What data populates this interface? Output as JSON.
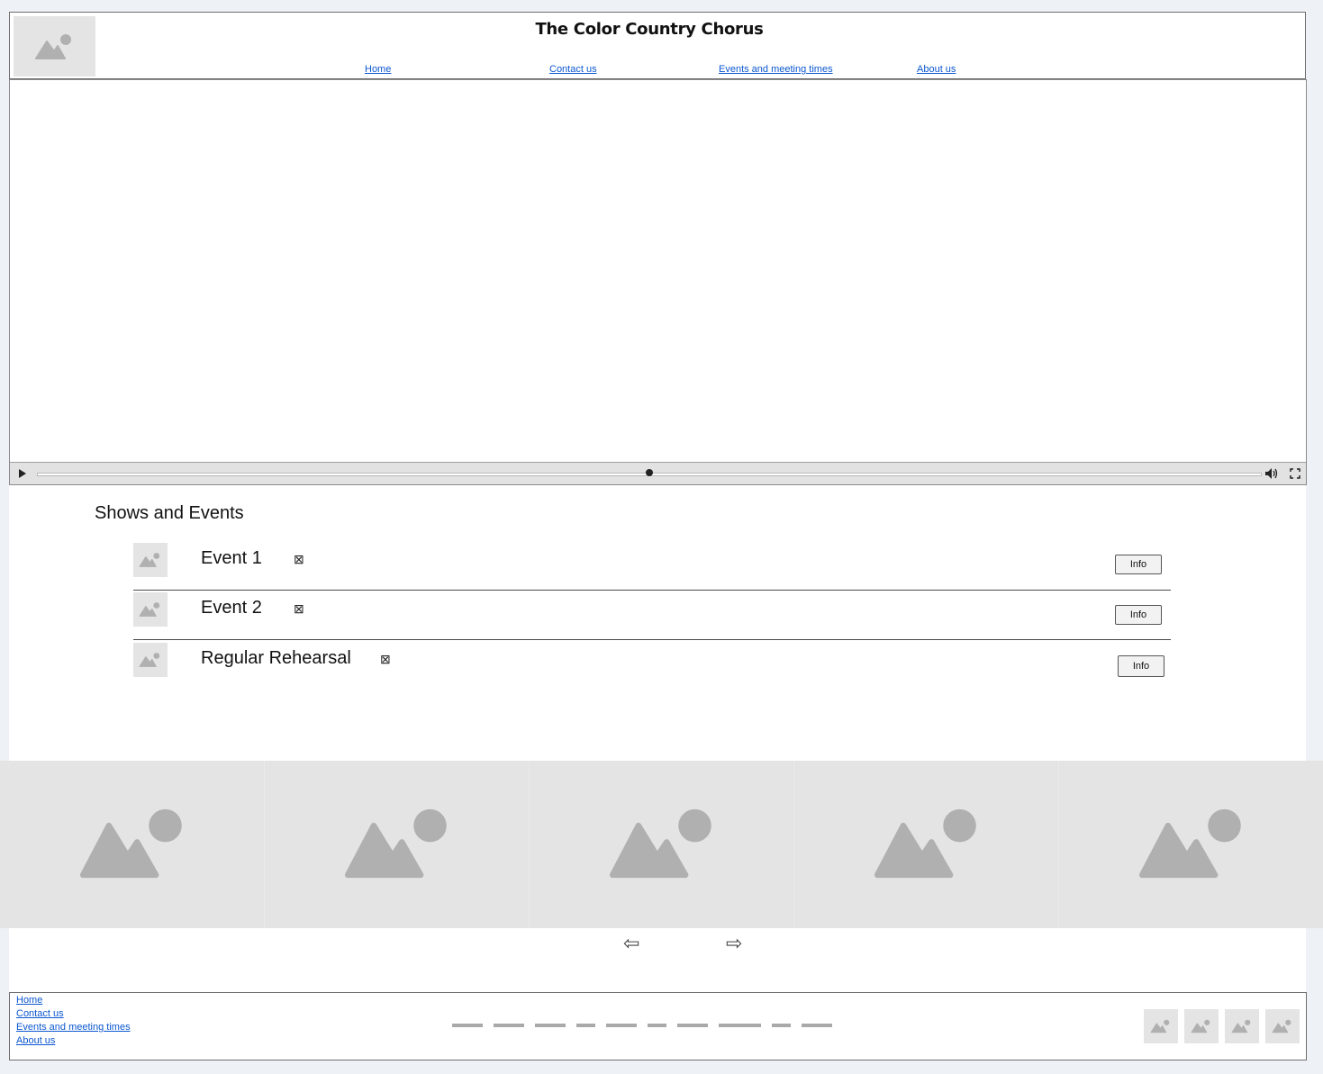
{
  "header": {
    "title": "The Color Country Chorus",
    "nav": [
      "Home",
      "Contact us",
      "Events and meeting times",
      "About us"
    ]
  },
  "video": {
    "progress": 0.5
  },
  "events": {
    "heading": "Shows and Events",
    "items": [
      {
        "name": "Event 1",
        "mark": "⊠",
        "button": "Info"
      },
      {
        "name": "Event 2",
        "mark": "⊠",
        "button": "Info"
      },
      {
        "name": "Regular Rehearsal",
        "mark": "⊠",
        "button": "Info"
      }
    ]
  },
  "gallery": {
    "prev": "⇦",
    "next": "⇨"
  },
  "footer": {
    "links": [
      "Home",
      "Contact us",
      "Events and meeting times",
      "About us"
    ]
  },
  "icons": {
    "image_placeholder": "image-placeholder-icon",
    "play": "play-icon",
    "volume": "volume-icon",
    "fullscreen": "fullscreen-icon"
  },
  "colors": {
    "link": "#0b57d0",
    "placeholder_bg": "#e4e4e4",
    "placeholder_fg": "#b0b0b0"
  }
}
